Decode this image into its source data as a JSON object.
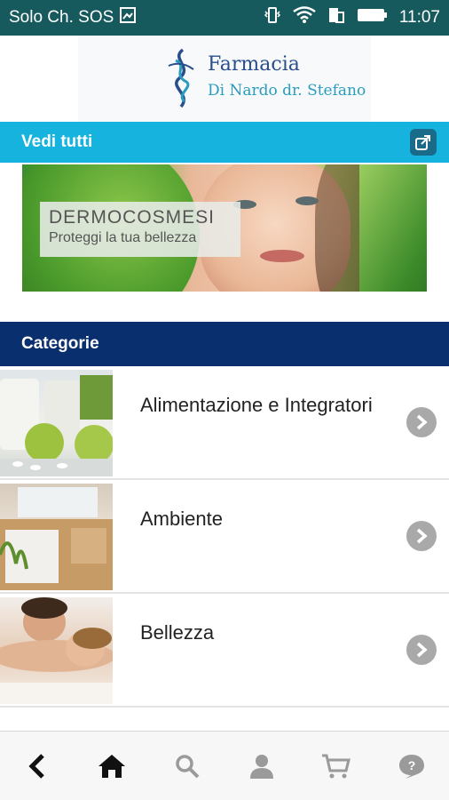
{
  "status_bar": {
    "carrier": "Solo Ch. SOS",
    "time": "11:07",
    "icons": [
      "screenshot-icon",
      "vibrate-icon",
      "wifi-icon",
      "sim-icon",
      "battery-icon"
    ]
  },
  "header": {
    "logo_line1": "Farmacia",
    "logo_line2": "Di Nardo dr. Stefano"
  },
  "featured": {
    "title": "Vedi tutti",
    "share_icon": "share-icon",
    "banner_title": "DERMOCOSMESI",
    "banner_subtitle": "Proteggi la tua bellezza"
  },
  "categories": {
    "title": "Categorie",
    "items": [
      {
        "label": "Alimentazione e Integratori"
      },
      {
        "label": "Ambiente"
      },
      {
        "label": "Bellezza"
      }
    ]
  },
  "bottom_nav": {
    "items": [
      "back-icon",
      "home-icon",
      "search-icon",
      "account-icon",
      "cart-icon",
      "help-chat-icon"
    ]
  },
  "colors": {
    "status_bar": "#165a5e",
    "vedi_bar": "#15b3dd",
    "categorie_bar": "#0a2f6e",
    "chevron": "#a9a9a9"
  }
}
